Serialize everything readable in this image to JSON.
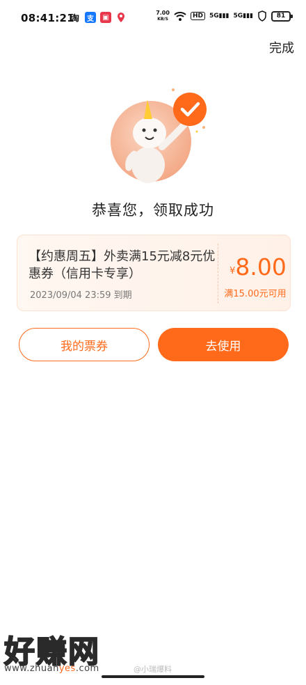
{
  "status_bar": {
    "time": "08:41:21",
    "app_icons": [
      "taobao-icon",
      "alipay-icon",
      "app-icon",
      "map-pin-icon"
    ],
    "net_speed_value": "7.00",
    "net_speed_unit": "KB/S",
    "hd_label": "HD",
    "signal1": "5G",
    "signal2": "5G",
    "battery": "81"
  },
  "header": {
    "done_label": "完成"
  },
  "main": {
    "congrats_text": "恭喜您，领取成功"
  },
  "coupon": {
    "title": "【约惠周五】外卖满15元减8元优惠券（信用卡专享）",
    "expiry": "2023/09/04 23:59 到期",
    "currency": "¥",
    "amount": "8.00",
    "condition": "满15.00元可用"
  },
  "actions": {
    "my_tickets_label": "我的票券",
    "use_label": "去使用"
  },
  "watermark": {
    "brand": "好赚网",
    "url_prefix": "www.zhuan",
    "url_highlight": "yes",
    "url_suffix": ".com",
    "weibo": "@小瑞爆料"
  },
  "colors": {
    "accent": "#ff6a1a",
    "card_bg": "#fff4ec"
  }
}
